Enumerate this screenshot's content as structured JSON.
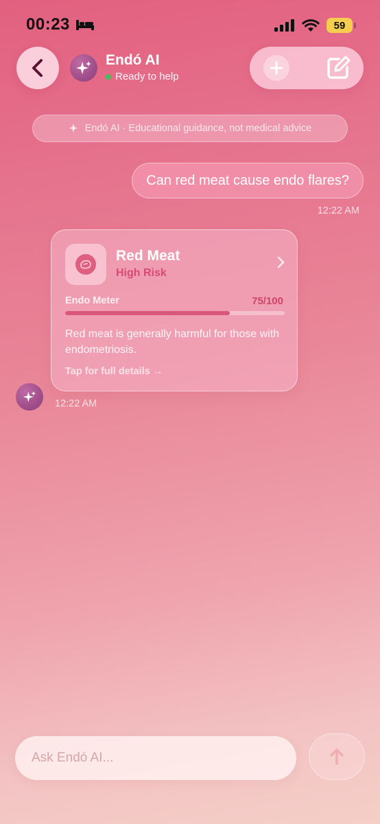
{
  "status_bar": {
    "time": "00:23",
    "battery": "59"
  },
  "header": {
    "title": "Endó AI",
    "status": "Ready to help",
    "icons": {
      "back": "chevron-left-icon",
      "new": "plus-icon",
      "compose": "compose-icon",
      "avatar": "sparkles-icon"
    }
  },
  "disclaimer": {
    "text": "Endó AI · Educational guidance, not medical advice"
  },
  "messages": {
    "user": {
      "text": "Can red meat cause endo flares?",
      "time": "12:22 AM"
    },
    "bot": {
      "time": "12:22 AM",
      "card": {
        "name": "Red Meat",
        "risk": "High Risk",
        "meter_label": "Endo Meter",
        "score": "75/100",
        "score_fraction": 0.75,
        "description": "Red meat is generally harmful for those with endometriosis.",
        "cta": "Tap for full details →"
      }
    }
  },
  "input": {
    "placeholder": "Ask Endó AI..."
  },
  "colors": {
    "accent": "#d84a73",
    "online": "#3fc25a",
    "battery": "#f5cd4f"
  }
}
